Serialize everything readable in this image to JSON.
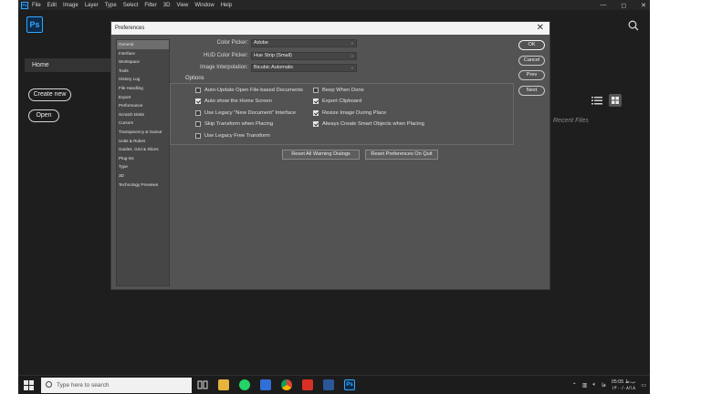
{
  "menubar": {
    "items": [
      "File",
      "Edit",
      "Image",
      "Layer",
      "Type",
      "Select",
      "Filter",
      "3D",
      "View",
      "Window",
      "Help"
    ],
    "logo": "Ps",
    "controls": [
      "—",
      "◻",
      "✕"
    ]
  },
  "home": {
    "logo": "Ps",
    "nav_home": "Home",
    "create_new": "Create new",
    "open": "Open",
    "recent_files": "Recent Files"
  },
  "dialog": {
    "title": "Preferences",
    "close": "✕",
    "nav_items": [
      "General",
      "Interface",
      "Workspace",
      "Tools",
      "History Log",
      "File Handling",
      "Export",
      "Performance",
      "Scratch Disks",
      "Cursors",
      "Transparency & Gamut",
      "Units & Rulers",
      "Guides, Grid & Slices",
      "Plug-ins",
      "Type",
      "3D",
      "Technology Previews"
    ],
    "selected_nav": "General",
    "fields": {
      "color_picker_label": "Color Picker:",
      "color_picker_value": "Adobe",
      "hud_picker_label": "HUD Color Picker:",
      "hud_picker_value": "Hue Strip (Small)",
      "interp_label": "Image Interpolation:",
      "interp_value": "Bicubic Automatic"
    },
    "options_title": "Options",
    "options": [
      {
        "label": "Auto-Update Open File-based Documents",
        "checked": false
      },
      {
        "label": "Beep When Done",
        "checked": false
      },
      {
        "label": "Auto show the Home Screen",
        "checked": true
      },
      {
        "label": "Export Clipboard",
        "checked": true
      },
      {
        "label": "Use Legacy \"New Document\" Interface",
        "checked": false
      },
      {
        "label": "Resize Image During Place",
        "checked": true
      },
      {
        "label": "Skip Transform when Placing",
        "checked": false
      },
      {
        "label": "Always Create Smart Objects when Placing",
        "checked": true
      },
      {
        "label": "Use Legacy Free Transform",
        "checked": false
      }
    ],
    "buttons": {
      "reset_warnings": "Reset All Warning Dialogs",
      "reset_prefs": "Reset Preferences On Quit",
      "ok": "OK",
      "cancel": "Cancel",
      "prev": "Prev",
      "next": "Next"
    }
  },
  "taskbar": {
    "search_placeholder": "Type here to search",
    "clock_time": "05:05 ب.ظ",
    "clock_date": "۱۴۰۰/۰۸/۱۸",
    "lang": "فا",
    "app_icons": [
      "task-view",
      "file-explorer",
      "whatsapp",
      "dropbox",
      "chrome",
      "wps",
      "word",
      "photoshop"
    ]
  },
  "colors": {
    "ps_blue": "#31a8ff",
    "dialog_bg": "#535353",
    "screen_bg": "#1e1e1e"
  }
}
